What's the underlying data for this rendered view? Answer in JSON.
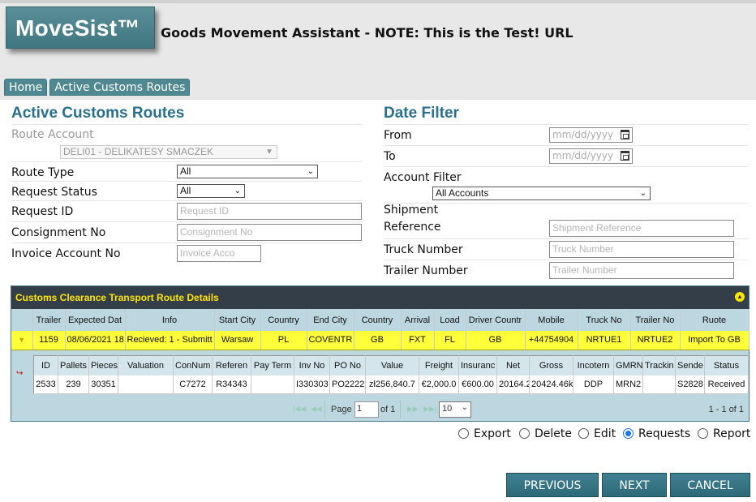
{
  "header": {
    "logo": "MoveSist™",
    "title": "Goods Movement Assistant - NOTE: This is the Test! URL"
  },
  "breadcrumbs": [
    "Home",
    "Active Customs Routes"
  ],
  "left": {
    "title": "Active Customs Routes",
    "route_account_label": "Route Account",
    "route_account_value": "DELI01 - DELIKATESY SMACZEK",
    "route_type_label": "Route Type",
    "route_type_value": "All",
    "request_status_label": "Request Status",
    "request_status_value": "All",
    "request_id_label": "Request ID",
    "request_id_placeholder": "Request ID",
    "consignment_label": "Consignment No",
    "consignment_placeholder": "Consignment No",
    "invoice_label": "Invoice Account No",
    "invoice_placeholder": "Invoice Acco"
  },
  "right": {
    "title": "Date Filter",
    "from_label": "From",
    "from_placeholder": "mm/dd/yyyy",
    "to_label": "To",
    "to_placeholder": "mm/dd/yyyy",
    "account_filter_label": "Account Filter",
    "account_filter_value": "All Accounts",
    "shipment_label_1": "Shipment",
    "shipment_label_2": "Reference",
    "shipment_placeholder": "Shipment Reference",
    "truck_label": "Truck Number",
    "truck_placeholder": "Truck Number",
    "trailer_label": "Trailer Number",
    "trailer_placeholder": "Trailer Number"
  },
  "grid": {
    "caption": "Customs Clearance Transport Route Details",
    "columns": [
      "Trailer",
      "Expected Dat",
      "Info",
      "Start City",
      "Country",
      "End City",
      "Country",
      "Arrival",
      "Load",
      "Driver Countr",
      "Mobile",
      "Truck No",
      "Trailer No",
      "Ruote"
    ],
    "rows": [
      [
        "1159",
        "08/06/2021 18",
        "Recieved: 1 - Submitt",
        "Warsaw",
        "PL",
        "COVENTR",
        "GB",
        "FXT",
        "FL",
        "GB",
        "+44754904",
        "NRTUE1",
        "NRTUE2",
        "Import To GB"
      ]
    ],
    "sub_columns": [
      "ID",
      "Pallets",
      "Pieces",
      "Valuation",
      "ConNum",
      "Referen",
      "Pay Term",
      "Inv No",
      "PO No",
      "Value",
      "Freight",
      "Insuranc",
      "Net",
      "Gross",
      "Incotern",
      "GMRN",
      "Trackin",
      "Sende",
      "Status"
    ],
    "sub_rows": [
      [
        "2533",
        "239",
        "30351",
        "",
        "C7272",
        "R34343",
        "",
        "I330303",
        "PO2222",
        "zł256,840.7",
        "€2,000.0",
        "€600.00",
        "20164.2",
        "20424.46k",
        "DDP",
        "MRN2",
        "",
        "S2828",
        "Received"
      ]
    ],
    "pager": {
      "page_label": "Page",
      "page_value": "1",
      "of_label": "of 1",
      "page_size": "10",
      "range": "1 - 1 of 1"
    }
  },
  "actions": {
    "radios": [
      {
        "label": "Export",
        "checked": false
      },
      {
        "label": "Delete",
        "checked": false
      },
      {
        "label": "Edit",
        "checked": false
      },
      {
        "label": "Requests",
        "checked": true
      },
      {
        "label": "Report",
        "checked": false
      }
    ],
    "previous": "PREVIOUS",
    "next": "NEXT",
    "cancel": "CANCEL"
  }
}
